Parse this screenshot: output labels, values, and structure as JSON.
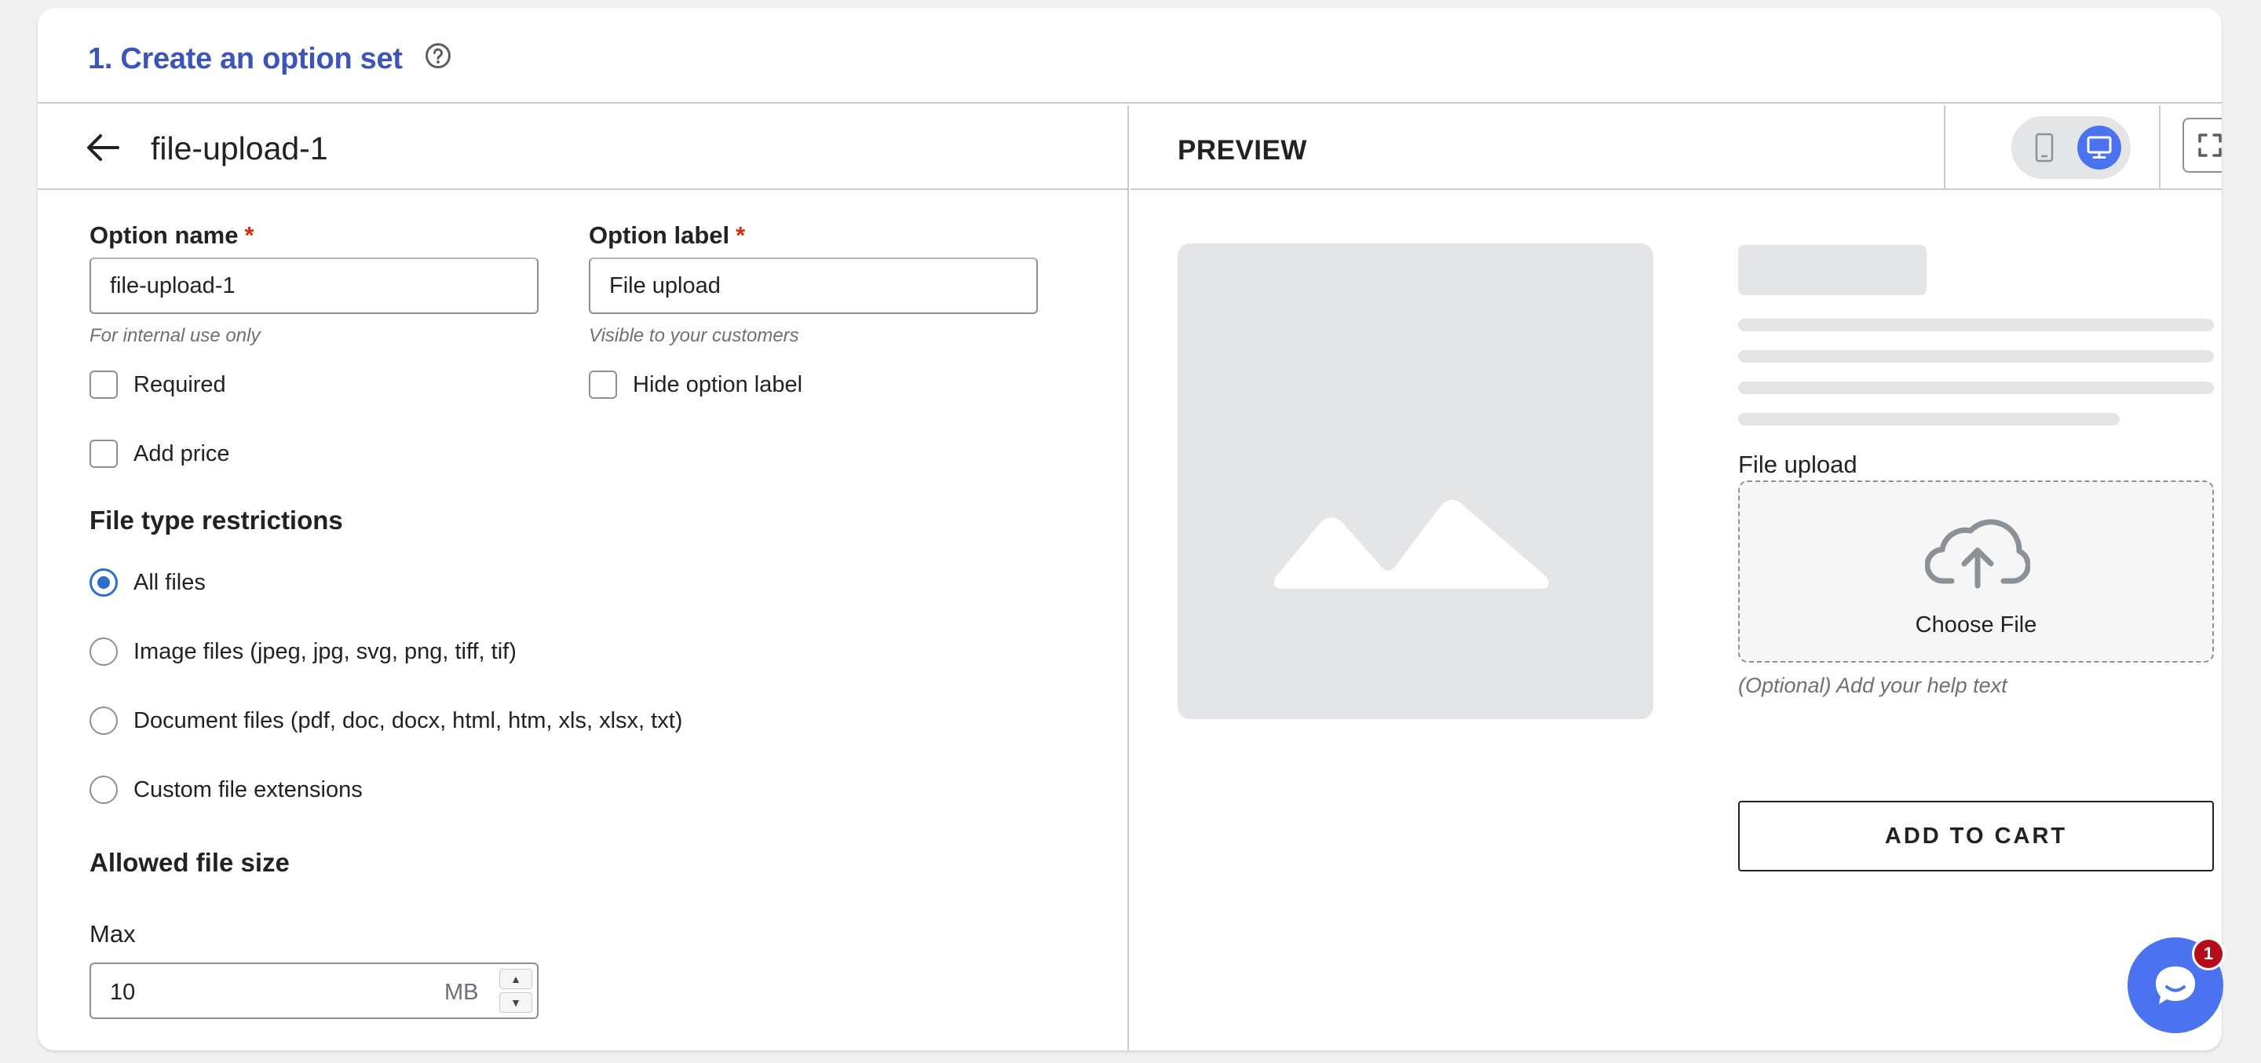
{
  "header": {
    "title": "1. Create an option set"
  },
  "editor": {
    "option_title": "file-upload-1",
    "option_name": {
      "label": "Option name",
      "value": "file-upload-1",
      "hint": "For internal use only"
    },
    "option_label": {
      "label": "Option label",
      "value": "File upload",
      "hint": "Visible to your customers"
    },
    "required_mark": "*",
    "checkboxes": {
      "required": "Required",
      "hide_label": "Hide option label",
      "add_price": "Add price"
    },
    "file_type": {
      "title": "File type restrictions",
      "options": [
        {
          "label": "All files",
          "selected": true
        },
        {
          "label": "Image files (jpeg, jpg, svg, png, tiff, tif)",
          "selected": false
        },
        {
          "label": "Document files (pdf, doc, docx, html, htm, xls, xlsx, txt)",
          "selected": false
        },
        {
          "label": "Custom file extensions",
          "selected": false
        }
      ]
    },
    "file_size": {
      "title": "Allowed file size",
      "max_label": "Max",
      "max_value": "10",
      "unit": "MB"
    }
  },
  "preview": {
    "title": "PREVIEW",
    "view_mode": "desktop",
    "upload_label": "File upload",
    "choose_file": "Choose File",
    "help_text": "(Optional) Add your help text",
    "add_to_cart": "ADD TO CART"
  },
  "chat": {
    "badge_count": "1"
  },
  "colors": {
    "accent": "#3c55b8",
    "primary": "#4b73f0",
    "radio_selected": "#2c6ecb",
    "required": "#d72c0d",
    "badge": "#b50e1a"
  }
}
